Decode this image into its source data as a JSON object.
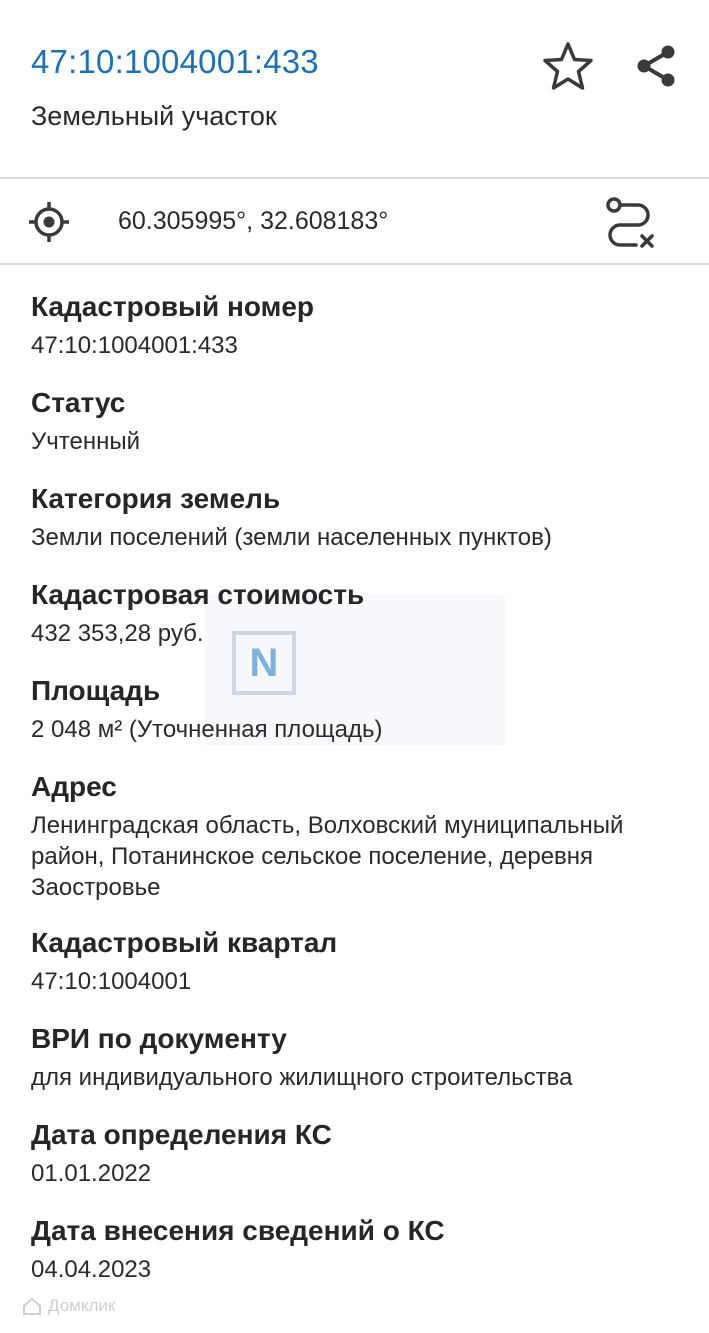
{
  "header": {
    "title": "47:10:1004001:433",
    "subtitle": "Земельный участок"
  },
  "coordinates": {
    "text": "60.305995°, 32.608183°"
  },
  "fields": [
    {
      "label": "Кадастровый номер",
      "value": "47:10:1004001:433"
    },
    {
      "label": "Статус",
      "value": "Учтенный"
    },
    {
      "label": "Категория земель",
      "value": "Земли поселений (земли населенных пунктов)"
    },
    {
      "label": "Кадастровая стоимость",
      "value": "432 353,28 руб."
    },
    {
      "label": "Площадь",
      "value": "2 048 м² (Уточненная площадь)"
    },
    {
      "label": "Адрес",
      "value": "Ленинградская область, Волховский муниципальный район, Потанинское сельское поселение, деревня Заостровье"
    },
    {
      "label": "Кадастровый квартал",
      "value": "47:10:1004001"
    },
    {
      "label": "ВРИ по документу",
      "value": "для индивидуального жилищного строительства"
    },
    {
      "label": "Дата определения КС",
      "value": "01.01.2022"
    },
    {
      "label": "Дата внесения сведений о КС",
      "value": "04.04.2023"
    }
  ],
  "watermark": {
    "logo_letter": "N"
  },
  "footer": {
    "brand": "Домклик"
  },
  "colors": {
    "accent": "#1e6fb5",
    "divider": "#d9d9d9",
    "icon": "#3a3a3a"
  },
  "icons": [
    "star-icon",
    "share-icon",
    "crosshair-icon",
    "route-icon"
  ]
}
